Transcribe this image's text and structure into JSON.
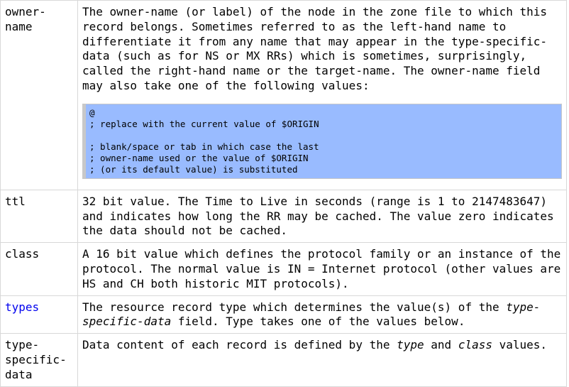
{
  "rows": [
    {
      "term": "owner-name",
      "desc": "The owner-name (or label) of the node in the zone file to which this record belongs. Sometimes referred to as the left-hand name to differentiate it from any name that may appear in the type-specific-data (such as for NS or MX RRs) which is sometimes, surprisingly, called the right-hand name or the target-name. The owner-name field may also take one of the following values:",
      "code": [
        "@",
        "; replace with the current value of $ORIGIN",
        "",
        "; blank/space or tab in which case the last",
        "; owner-name used or the value of $ORIGIN",
        "; (or its default value) is substituted"
      ]
    },
    {
      "term": "ttl",
      "desc": "32 bit value. The Time to Live in seconds (range is 1 to 2147483647) and indicates how long the RR may be cached. The value zero indicates the data should not be cached."
    },
    {
      "term": "class",
      "desc": "A 16 bit value which defines the protocol family or an instance of the protocol. The normal value is IN = Internet protocol (other values are HS and CH both historic MIT protocols)."
    },
    {
      "term": "types",
      "desc_pre": "The resource record type which determines the value(s) of the ",
      "desc_em": "type-specific-data",
      "desc_post": " field. Type takes one of the values below."
    },
    {
      "term": "type-specific-data",
      "desc_pre": "Data content of each record is defined by the ",
      "desc_em1": "type",
      "desc_mid": " and ",
      "desc_em2": "class",
      "desc_post": " values."
    }
  ]
}
